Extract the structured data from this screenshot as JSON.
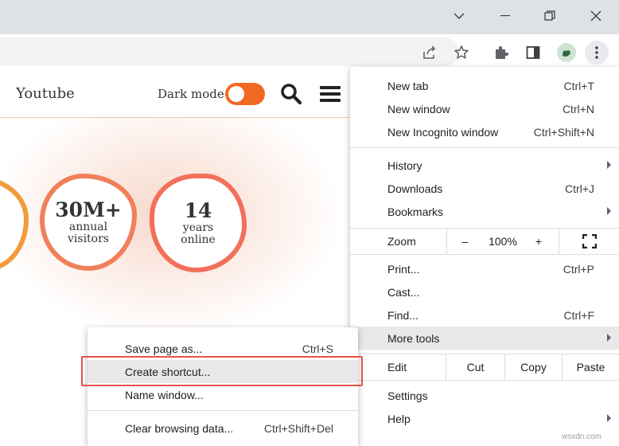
{
  "window_controls": {
    "dropdown": "chevron-down",
    "minimize": "minimize",
    "restore": "restore",
    "close": "close"
  },
  "website": {
    "title": "Youtube",
    "dark_mode_label": "Dark mode",
    "stats": [
      {
        "number": "30M+",
        "line1": "annual",
        "line2": "visitors"
      },
      {
        "number": "14",
        "line1": "years",
        "line2": "online"
      }
    ]
  },
  "menu": {
    "new_tab": {
      "label": "New tab",
      "shortcut": "Ctrl+T"
    },
    "new_window": {
      "label": "New window",
      "shortcut": "Ctrl+N"
    },
    "new_incognito": {
      "label": "New Incognito window",
      "shortcut": "Ctrl+Shift+N"
    },
    "history": {
      "label": "History"
    },
    "downloads": {
      "label": "Downloads",
      "shortcut": "Ctrl+J"
    },
    "bookmarks": {
      "label": "Bookmarks"
    },
    "zoom": {
      "label": "Zoom",
      "minus": "–",
      "level": "100%",
      "plus": "+"
    },
    "print": {
      "label": "Print...",
      "shortcut": "Ctrl+P"
    },
    "cast": {
      "label": "Cast..."
    },
    "find": {
      "label": "Find...",
      "shortcut": "Ctrl+F"
    },
    "more_tools": {
      "label": "More tools"
    },
    "edit": {
      "label": "Edit",
      "cut": "Cut",
      "copy": "Copy",
      "paste": "Paste"
    },
    "settings": {
      "label": "Settings"
    },
    "help": {
      "label": "Help"
    }
  },
  "submenu": {
    "save_page": {
      "label": "Save page as...",
      "shortcut": "Ctrl+S"
    },
    "create_shortcut": {
      "label": "Create shortcut..."
    },
    "name_window": {
      "label": "Name window..."
    },
    "clear_data": {
      "label": "Clear browsing data...",
      "shortcut": "Ctrl+Shift+Del"
    }
  },
  "watermark": "wsxdn.com",
  "colors": {
    "accent_orange": "#f26a21",
    "highlight_box": "#e8514a",
    "menu_hover": "#e8e8e8"
  }
}
